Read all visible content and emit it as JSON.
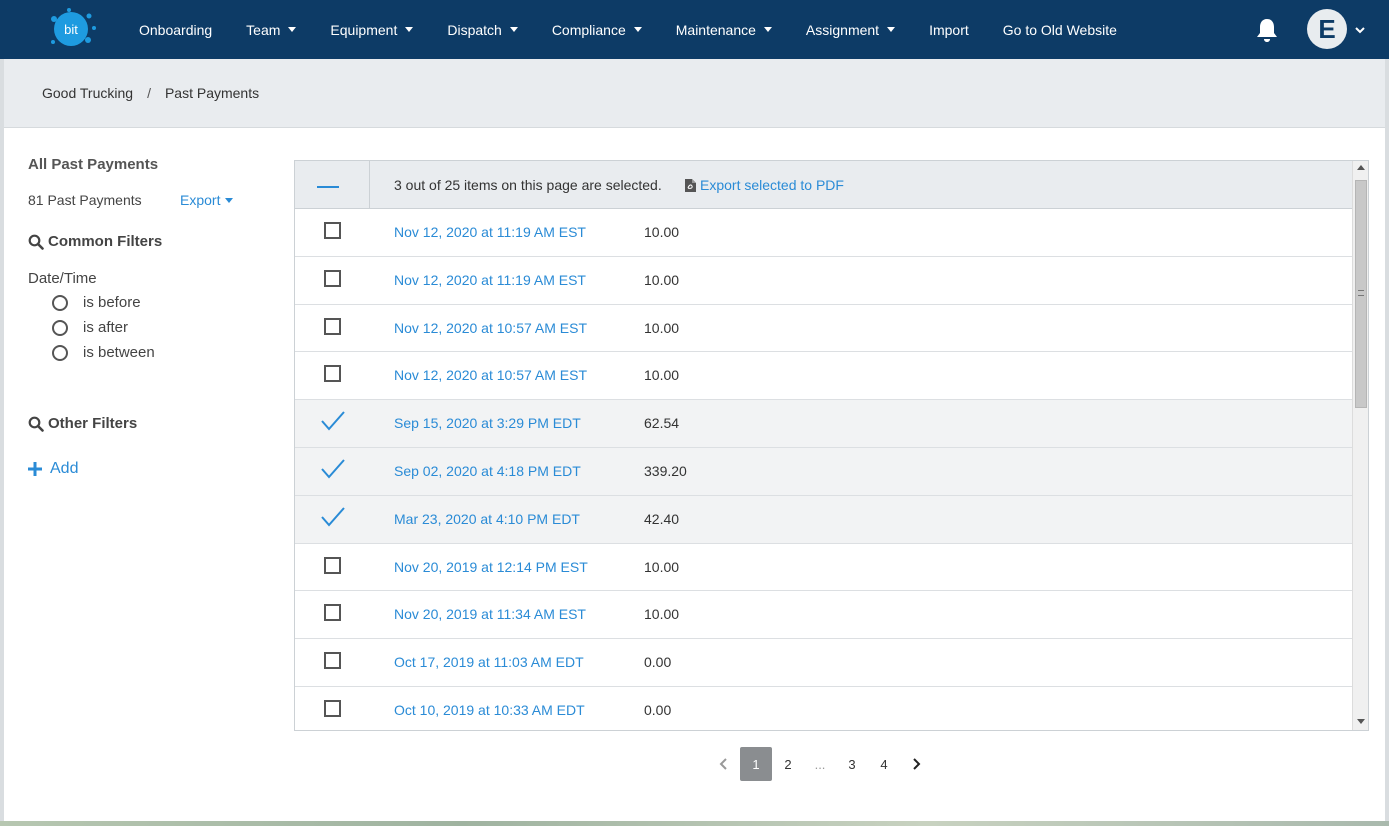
{
  "nav": {
    "logo_text": "bit",
    "items": [
      {
        "label": "Onboarding",
        "dropdown": false
      },
      {
        "label": "Team",
        "dropdown": true
      },
      {
        "label": "Equipment",
        "dropdown": true
      },
      {
        "label": "Dispatch",
        "dropdown": true
      },
      {
        "label": "Compliance",
        "dropdown": true
      },
      {
        "label": "Maintenance",
        "dropdown": true
      },
      {
        "label": "Assignment",
        "dropdown": true
      },
      {
        "label": "Import",
        "dropdown": false
      },
      {
        "label": "Go to Old Website",
        "dropdown": false
      }
    ],
    "avatar_initial": "E",
    "bell_icon": "bell-icon"
  },
  "breadcrumb": {
    "items": [
      "Good Trucking",
      "Past Payments"
    ],
    "separator": "/"
  },
  "sidebar": {
    "title": "All Past Payments",
    "count_label": "81 Past Payments",
    "export_label": "Export",
    "common_filters_label": "Common Filters",
    "date_time_label": "Date/Time",
    "date_options": [
      "is before",
      "is after",
      "is between"
    ],
    "other_filters_label": "Other Filters",
    "add_label": "Add"
  },
  "table": {
    "selection_text": "3 out of 25 items on this page are selected.",
    "export_pdf_label": "Export selected to PDF",
    "rows": [
      {
        "date": "Nov 12, 2020 at 11:19 AM EST",
        "amount": "10.00",
        "checked": false
      },
      {
        "date": "Nov 12, 2020 at 11:19 AM EST",
        "amount": "10.00",
        "checked": false
      },
      {
        "date": "Nov 12, 2020 at 10:57 AM EST",
        "amount": "10.00",
        "checked": false
      },
      {
        "date": "Nov 12, 2020 at 10:57 AM EST",
        "amount": "10.00",
        "checked": false
      },
      {
        "date": "Sep 15, 2020 at 3:29 PM EDT",
        "amount": "62.54",
        "checked": true
      },
      {
        "date": "Sep 02, 2020 at 4:18 PM EDT",
        "amount": "339.20",
        "checked": true
      },
      {
        "date": "Mar 23, 2020 at 4:10 PM EDT",
        "amount": "42.40",
        "checked": true
      },
      {
        "date": "Nov 20, 2019 at 12:14 PM EST",
        "amount": "10.00",
        "checked": false
      },
      {
        "date": "Nov 20, 2019 at 11:34 AM EST",
        "amount": "10.00",
        "checked": false
      },
      {
        "date": "Oct 17, 2019 at 11:03 AM EDT",
        "amount": "0.00",
        "checked": false
      },
      {
        "date": "Oct 10, 2019 at 10:33 AM EDT",
        "amount": "0.00",
        "checked": false
      }
    ]
  },
  "pagination": {
    "pages": [
      "1",
      "2",
      "...",
      "3",
      "4"
    ],
    "current": "1"
  },
  "colors": {
    "nav_bg": "#0d3b66",
    "link": "#2a8bd6",
    "header_bg": "#e9ecef",
    "active_page": "#8a8d90"
  }
}
